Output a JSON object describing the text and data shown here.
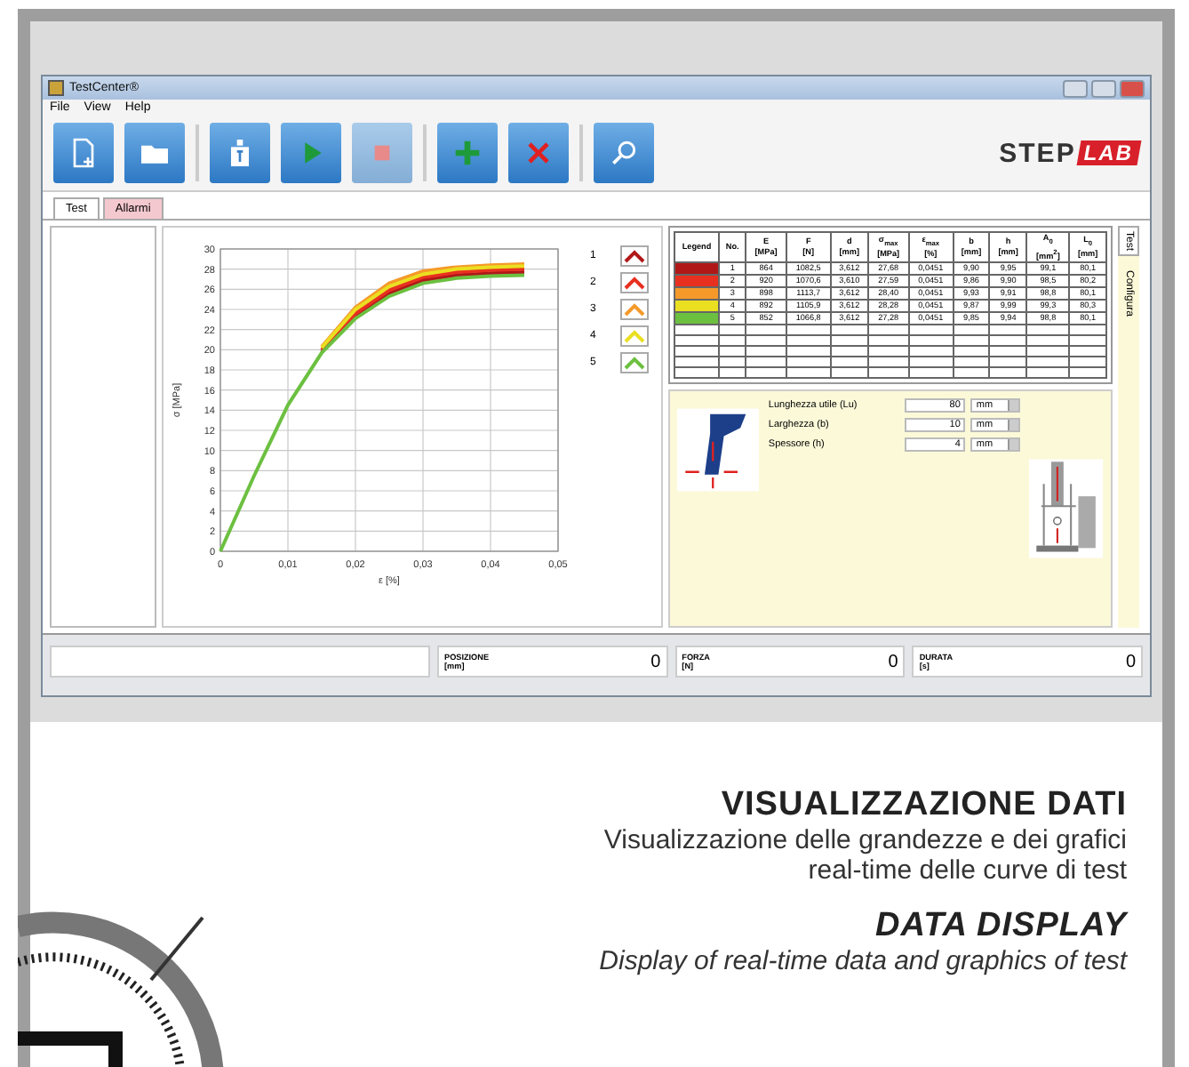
{
  "window": {
    "title": "TestCenter®"
  },
  "menu": [
    "File",
    "View",
    "Help"
  ],
  "toolbar": [
    [
      {
        "kind": "new",
        "disabled": false
      },
      {
        "kind": "open",
        "disabled": false
      }
    ],
    [
      {
        "kind": "weight",
        "disabled": false
      },
      {
        "kind": "play",
        "disabled": false
      },
      {
        "kind": "stop",
        "disabled": true
      }
    ],
    [
      {
        "kind": "add",
        "disabled": false
      },
      {
        "kind": "delete",
        "disabled": false
      }
    ],
    [
      {
        "kind": "search",
        "disabled": false
      }
    ]
  ],
  "logo": {
    "left": "STEP",
    "right": "LAB"
  },
  "tabs": [
    {
      "label": "Test",
      "selected": true
    },
    {
      "label": "Allarmi",
      "selected": false
    }
  ],
  "chart": {
    "chart_data": {
      "type": "line",
      "grid": true,
      "xlabel": "ε [%]",
      "ylabel": "σ [MPa]",
      "x": [
        0,
        0.005,
        0.01,
        0.015,
        0.02,
        0.025,
        0.03,
        0.035,
        0.04,
        0.045
      ],
      "xlim": [
        0,
        0.05
      ],
      "ylim": [
        0,
        30
      ],
      "xticks": [
        {
          "value": 0,
          "label": "0"
        },
        {
          "value": 0.01,
          "label": "0,01"
        },
        {
          "value": 0.02,
          "label": "0,02"
        },
        {
          "value": 0.03,
          "label": "0,03"
        },
        {
          "value": 0.04,
          "label": "0,04"
        },
        {
          "value": 0.05,
          "label": "0,05"
        }
      ],
      "yticks": [
        0,
        2,
        4,
        6,
        8,
        10,
        12,
        14,
        16,
        18,
        20,
        22,
        24,
        26,
        28,
        30
      ],
      "series": [
        {
          "name": "1",
          "color": "#b01818",
          "values": [
            null,
            null,
            null,
            19.8,
            23.3,
            25.6,
            26.9,
            27.4,
            27.6,
            27.7
          ]
        },
        {
          "name": "2",
          "color": "#e83020",
          "values": [
            null,
            null,
            null,
            20,
            23.6,
            25.9,
            27.2,
            27.7,
            27.9,
            28.0
          ]
        },
        {
          "name": "3",
          "color": "#f59a2a",
          "values": [
            null,
            null,
            null,
            20.3,
            24.2,
            26.6,
            27.8,
            28.2,
            28.4,
            28.5
          ]
        },
        {
          "name": "4",
          "color": "#eadf20",
          "values": [
            null,
            null,
            null,
            20.2,
            24.0,
            26.3,
            27.5,
            28.0,
            28.2,
            28.3
          ]
        },
        {
          "name": "5",
          "color": "#6cc040",
          "values": [
            0,
            7.5,
            14.5,
            19.7,
            23.1,
            25.3,
            26.6,
            27.1,
            27.3,
            27.4
          ]
        }
      ]
    }
  },
  "results_table": {
    "columns": [
      "Legend",
      "No.",
      "E\n[MPa]",
      "F\n[N]",
      "d\n[mm]",
      "σ$_{max}$\n[MPa]",
      "ε$_{max}$\n[%]",
      "b\n[mm]",
      "h\n[mm]",
      "A$_{0}$\n[mm$^{2}$]",
      "L$_{0}$\n[mm]"
    ],
    "rows": [
      {
        "color": "#b01818",
        "cells": [
          "",
          "1",
          "864",
          "1082,5",
          "3,612",
          "27,68",
          "0,0451",
          "9,90",
          "9,95",
          "99,1",
          "80,1"
        ]
      },
      {
        "color": "#e83020",
        "cells": [
          "",
          "2",
          "920",
          "1070,6",
          "3,610",
          "27,59",
          "0,0451",
          "9,86",
          "9,90",
          "98,5",
          "80,2"
        ]
      },
      {
        "color": "#f59a2a",
        "cells": [
          "",
          "3",
          "898",
          "1113,7",
          "3,612",
          "28,40",
          "0,0451",
          "9,93",
          "9,91",
          "98,8",
          "80,1"
        ]
      },
      {
        "color": "#eadf20",
        "cells": [
          "",
          "4",
          "892",
          "1105,9",
          "3,612",
          "28,28",
          "0,0451",
          "9,87",
          "9,99",
          "99,3",
          "80,3"
        ]
      },
      {
        "color": "#6cc040",
        "cells": [
          "",
          "5",
          "852",
          "1066,8",
          "3,612",
          "27,28",
          "0,0451",
          "9,85",
          "9,94",
          "98,8",
          "80,1"
        ]
      }
    ]
  },
  "side_tabs": [
    {
      "label": "Test",
      "selected": true
    },
    {
      "label": "Configura",
      "selected": false
    }
  ],
  "parameters": [
    {
      "label": "Lunghezza utile (Lu)",
      "value": "80",
      "unit": "mm"
    },
    {
      "label": "Larghezza (b)",
      "value": "10",
      "unit": "mm"
    },
    {
      "label": "Spessore (h)",
      "value": "4",
      "unit": "mm"
    }
  ],
  "status": [
    {
      "label": "POSIZIONE\n[mm]",
      "value": "0"
    },
    {
      "label": "FORZA\n[N]",
      "value": "0"
    },
    {
      "label": "DURATA\n[s]",
      "value": "0"
    }
  ],
  "caption": {
    "title_it": "VISUALIZZAZIONE DATI",
    "text_it": "Visualizzazione delle grandezze e dei grafici\nreal-time delle curve di test",
    "title_en": "DATA DISPLAY",
    "text_en": "Display of real-time data and graphics of test"
  }
}
